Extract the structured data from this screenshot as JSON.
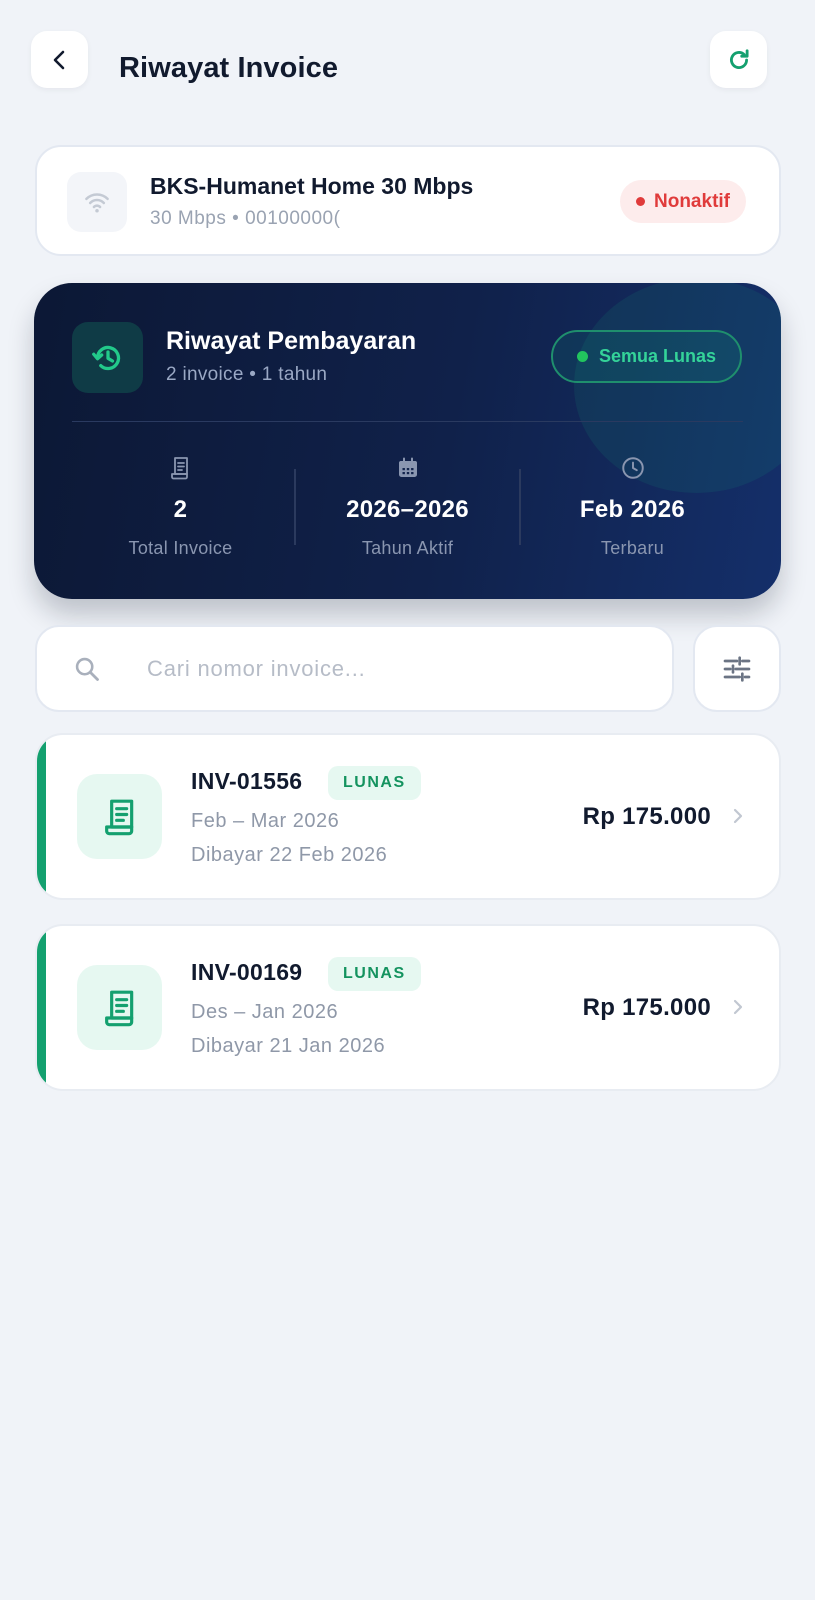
{
  "header": {
    "title": "Riwayat Invoice",
    "back_icon": "chevron-left-icon",
    "refresh_icon": "refresh-icon",
    "accent_color": "#14a06f"
  },
  "plan": {
    "name": "BKS-Humanet Home 30 Mbps",
    "subtitle": "30 Mbps • 00100000(",
    "icon": "wifi-icon",
    "status_label": "Nonaktif",
    "status_color": "#e03b3b"
  },
  "summary": {
    "title": "Riwayat Pembayaran",
    "subtitle": "2 invoice • 1 tahun",
    "badge_label": "Semua Lunas",
    "icon": "history-icon",
    "stats": [
      {
        "icon": "receipt-icon",
        "value": "2",
        "label": "Total Invoice"
      },
      {
        "icon": "calendar-icon",
        "value": "2026–2026",
        "label": "Tahun Aktif"
      },
      {
        "icon": "clock-icon",
        "value": "Feb 2026",
        "label": "Terbaru"
      }
    ]
  },
  "search": {
    "placeholder": "Cari nomor invoice...",
    "value": "",
    "icon": "search-icon",
    "filter_icon": "filter-sliders-icon"
  },
  "invoices": [
    {
      "number": "INV-01556",
      "status": "LUNAS",
      "period": "Feb – Mar 2026",
      "paid": "Dibayar 22 Feb 2026",
      "amount": "Rp 175.000"
    },
    {
      "number": "INV-00169",
      "status": "LUNAS",
      "period": "Des – Jan 2026",
      "paid": "Dibayar 21 Jan 2026",
      "amount": "Rp 175.000"
    }
  ]
}
